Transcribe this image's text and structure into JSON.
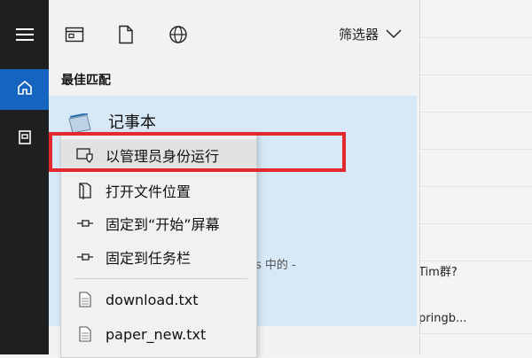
{
  "filter": {
    "label": "筛选器"
  },
  "section": {
    "best_match": "最佳匹配"
  },
  "app": {
    "name": "记事本"
  },
  "context_menu": {
    "items": [
      {
        "label": "以管理员身份运行",
        "icon": "shield-icon"
      },
      {
        "label": "打开文件位置",
        "icon": "folder-icon"
      },
      {
        "label": "固定到“开始”屏幕",
        "icon": "pin-icon"
      },
      {
        "label": "固定到任务栏",
        "icon": "pin-icon"
      }
    ],
    "files": [
      {
        "label": "download.txt",
        "icon": "text-file-icon"
      },
      {
        "label": "paper_new.txt",
        "icon": "text-file-icon"
      }
    ]
  },
  "partial_text": {
    "in_label": "s 中的 -",
    "tim_group": "Tim群?",
    "springb": "pringb..."
  },
  "colors": {
    "accent": "#1565c0",
    "highlight": "#e3282f",
    "selection": "#d7e8f7"
  }
}
